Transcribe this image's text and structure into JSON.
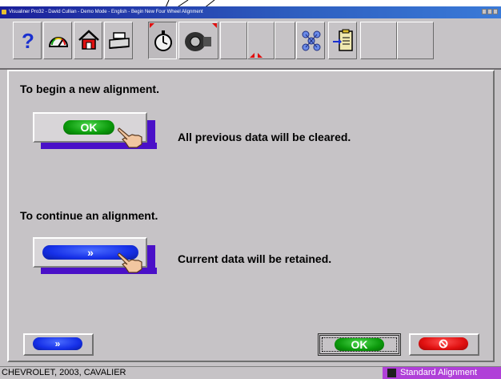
{
  "window": {
    "title": "Visualiner Pro32 - David Cullian - Demo Mode - English - Begin New Four Wheel Alignment"
  },
  "toolbar": {
    "buttons": [
      {
        "name": "help",
        "icon": "question-mark-icon"
      },
      {
        "name": "gauge",
        "icon": "speedometer-icon"
      },
      {
        "name": "home",
        "icon": "home-icon"
      },
      {
        "name": "print",
        "icon": "printer-icon"
      },
      {
        "name": "timer",
        "icon": "stopwatch-icon"
      },
      {
        "name": "wheel",
        "icon": "tire-icon"
      },
      {
        "name": "indicator",
        "icon": "red-arrows-icon"
      },
      {
        "name": "network",
        "icon": "molecule-icon"
      },
      {
        "name": "clipboard",
        "icon": "clipboard-arrow-icon"
      }
    ]
  },
  "main": {
    "new_heading": "To begin a new alignment.",
    "new_button_label": "OK",
    "new_note": "All previous data will be cleared.",
    "continue_heading": "To continue an alignment.",
    "continue_button_label": "»",
    "continue_note": "Current data will be retained."
  },
  "footer": {
    "next_label": "»",
    "ok_label": "OK",
    "cancel_icon": "cancel-icon"
  },
  "statusbar": {
    "vehicle": "CHEVROLET, 2003, CAVALIER",
    "mode": "Standard Alignment"
  },
  "colors": {
    "accent_green": "#0c9a0c",
    "accent_blue": "#1630e8",
    "accent_red": "#e01010",
    "shadow_purple": "#4a10c8",
    "mode_bg": "#b040d8"
  }
}
